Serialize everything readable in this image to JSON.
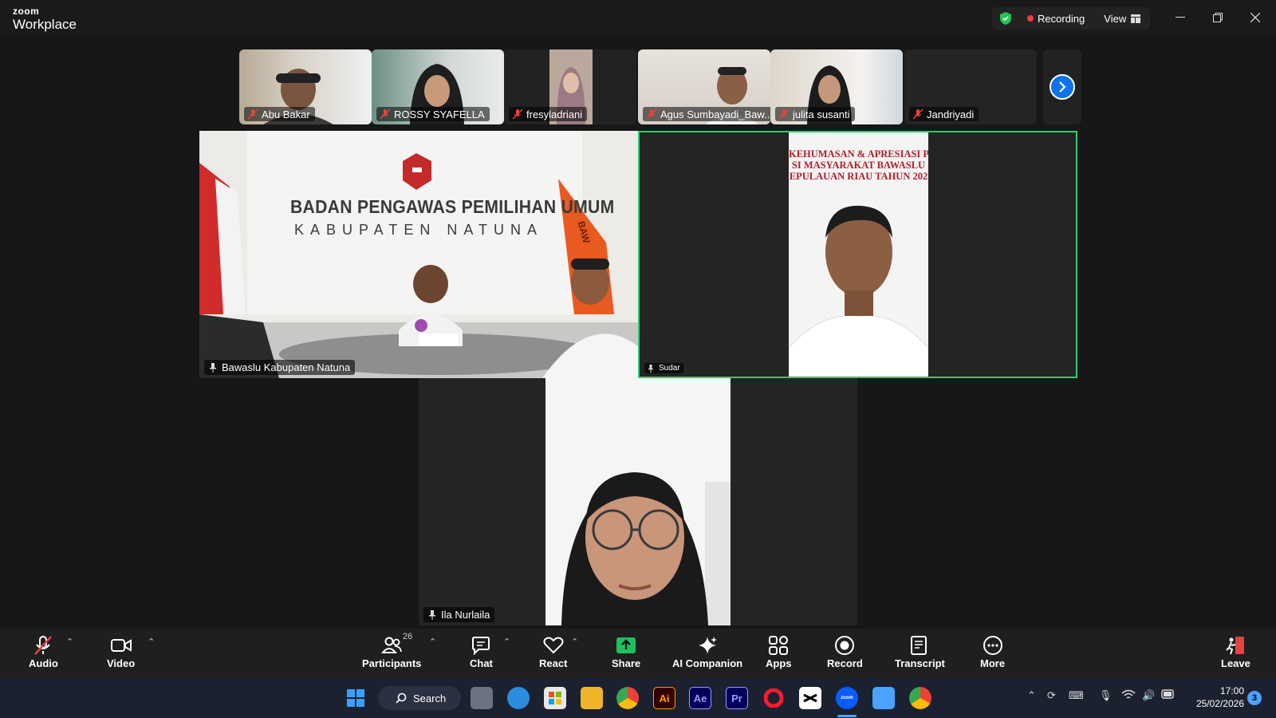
{
  "app": {
    "brand_small": "zoom",
    "brand_name": "Workplace"
  },
  "header": {
    "recording_label": "Recording",
    "view_label": "View"
  },
  "strip": {
    "participants": [
      {
        "name": "Abu Bakar",
        "muted": true
      },
      {
        "name": "ROSSY SYAFELLA",
        "muted": true
      },
      {
        "name": "fresyladriani",
        "muted": true
      },
      {
        "name": "Agus Sumbayadi_Baw...",
        "muted": true
      },
      {
        "name": "julita susanti",
        "muted": true
      },
      {
        "name": "Jandriyadi",
        "muted": true
      }
    ]
  },
  "gallery": {
    "tile1": {
      "name": "Bawaslu Kabupaten Natuna",
      "banner_line1": "BADAN PENGAWAS PEMILIHAN UMUM",
      "banner_line2": "KABUPATEN NATUNA",
      "flag_text": "BAW"
    },
    "tile2": {
      "name": "Sudar",
      "slide_line1": "KEHUMASAN & APRESIASI P",
      "slide_line2": "SI MASYARAKAT BAWASLU",
      "slide_line3": "EPULAUAN RIAU TAHUN 202"
    },
    "tile3": {
      "name": "Ila Nurlaila"
    }
  },
  "toolbar": {
    "audio": "Audio",
    "video": "Video",
    "participants": "Participants",
    "participants_count": "26",
    "chat": "Chat",
    "react": "React",
    "share": "Share",
    "ai_companion": "AI Companion",
    "apps": "Apps",
    "record": "Record",
    "transcript": "Transcript",
    "more": "More",
    "leave": "Leave"
  },
  "taskbar": {
    "search_label": "Search",
    "time": "17:00",
    "date": "25/02/2026",
    "notification_count": "3",
    "apps": [
      "Ai",
      "Ae",
      "Pr"
    ]
  },
  "colors": {
    "accent_blue": "#0e72ed",
    "active_speaker_green": "#2ecc71",
    "recording_red": "#e5433f",
    "share_green": "#1fbf5f",
    "leave_red": "#e5433f"
  }
}
